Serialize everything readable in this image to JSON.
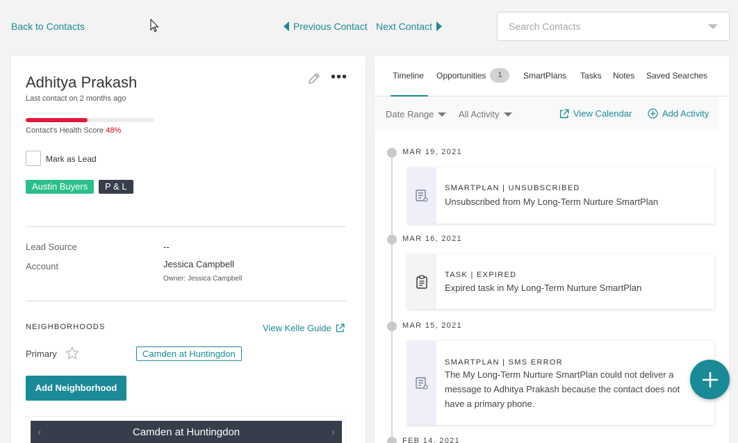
{
  "nav": {
    "back": "Back to Contacts",
    "previous": "Previous Contact",
    "next": "Next Contact",
    "search_placeholder": "Search Contacts"
  },
  "contact": {
    "name": "Adhitya Prakash",
    "last_contact": "Last contact on 2 months ago",
    "health_label": "Contact's Health Score",
    "health_pct_text": "48%",
    "health_value": 0.48,
    "mark_as_lead": "Mark as Lead",
    "tags": [
      "Austin Buyers",
      "P & L"
    ],
    "lead_source_label": "Lead Source",
    "lead_source_value": "--",
    "account_label": "Account",
    "account_value": "Jessica Campbell",
    "account_owner": "Owner: Jessica Campbell"
  },
  "neighborhoods": {
    "heading": "NEIGHBORHOODS",
    "guide_link": "View Kelle Guide",
    "primary_label": "Primary",
    "primary_value": "Camden at Huntingdon",
    "add_button": "Add Neighborhood",
    "carousel_title": "Camden at Huntingdon"
  },
  "tabs": {
    "timeline": "Timeline",
    "opportunities": "Opportunities",
    "opportunities_count": "1",
    "smartplans": "SmartPlans",
    "tasks": "Tasks",
    "notes": "Notes",
    "saved_searches": "Saved Searches"
  },
  "filters": {
    "date_range": "Date Range",
    "all_activity": "All Activity",
    "view_calendar": "View Calendar",
    "add_activity": "Add Activity"
  },
  "timeline": [
    {
      "date": "MAR 19, 2021",
      "type": "SMARTPLAN | UNSUBSCRIBED",
      "desc": "Unsubscribed from My Long-Term Nurture SmartPlan",
      "icon": "smartplan-icon"
    },
    {
      "date": "MAR 16, 2021",
      "type": "TASK | EXPIRED",
      "desc": "Expired task in My Long-Term Nurture SmartPlan",
      "icon": "clipboard-icon"
    },
    {
      "date": "MAR 15, 2021",
      "type": "SMARTPLAN | SMS ERROR",
      "desc": "The My Long-Term Nurture SmartPlan could not deliver a message to Adhitya Prakash because the contact does not have a primary phone.",
      "icon": "smartplan-icon"
    },
    {
      "date": "FEB 14, 2021"
    }
  ],
  "colors": {
    "accent": "#1a8a96",
    "health": "#e3183d",
    "tag_green": "#2bbf8a",
    "tag_dark": "#373d4b"
  }
}
